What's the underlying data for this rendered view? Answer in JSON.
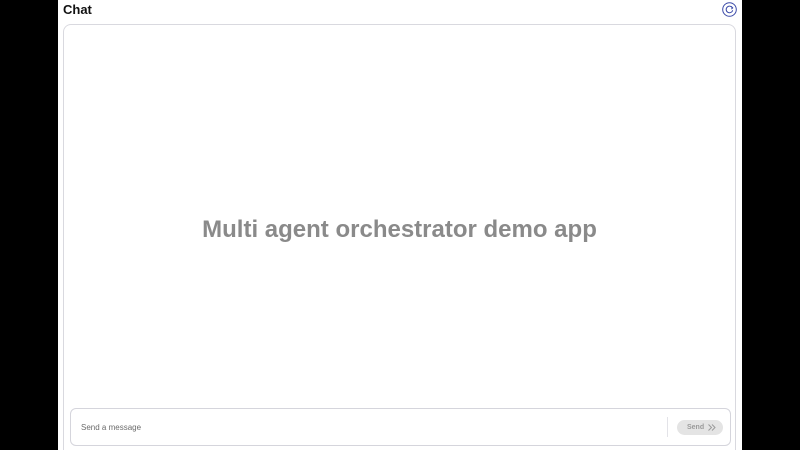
{
  "header": {
    "title": "Chat",
    "refresh_icon": "refresh-icon"
  },
  "chat": {
    "welcome_text": "Multi agent orchestrator demo app"
  },
  "composer": {
    "placeholder": "Send a message",
    "value": "",
    "send_label": "Send",
    "send_icon": "chevron-double-right-icon"
  },
  "colors": {
    "accent": "#3b4aa8",
    "welcome_text": "#8a8a8a",
    "send_button_bg": "#e4e4e4"
  }
}
